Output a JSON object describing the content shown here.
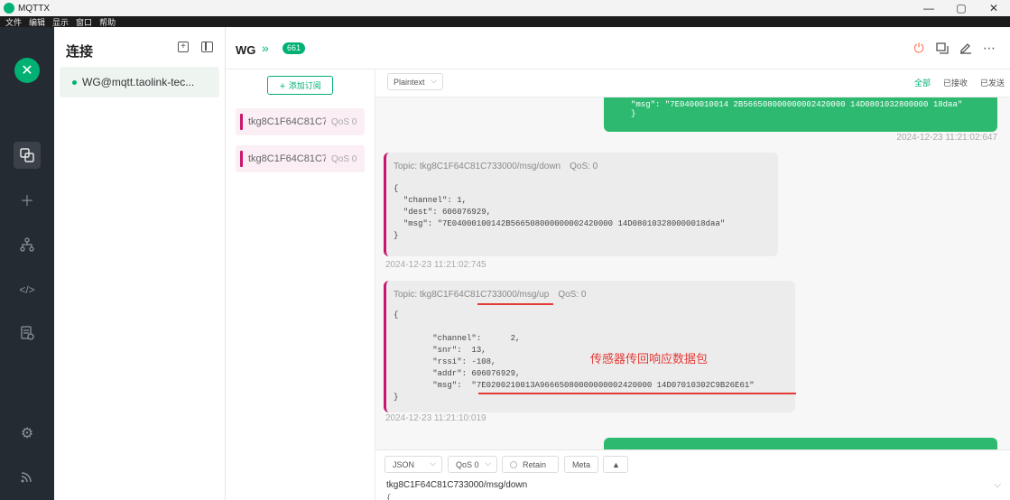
{
  "window": {
    "title": "MQTTX",
    "controls": [
      "—",
      "▢",
      "✕"
    ]
  },
  "menu": [
    "文件",
    "编辑",
    "显示",
    "窗口",
    "帮助"
  ],
  "nav": {
    "logo": "✕",
    "icons": [
      "connections-icon",
      "plus-icon",
      "scripts-icon",
      "code-icon",
      "log-icon",
      "settings-icon",
      "subscribe-icon"
    ]
  },
  "connections": {
    "title": "连接",
    "items": [
      {
        "name": "WG@mqtt.taolink-tec...",
        "status": "connected"
      }
    ]
  },
  "header": {
    "name": "WG",
    "badge": "661"
  },
  "subscriptions": {
    "add_label": "+ 添加订阅",
    "items": [
      {
        "topic": "tkg8C1F64C81C7...",
        "qos": "QoS 0"
      },
      {
        "topic": "tkg8C1F64C81C7...",
        "qos": "QoS 0"
      }
    ]
  },
  "messages": {
    "format": "Plaintext",
    "tabs": [
      "全部",
      "已接收",
      "已发送"
    ],
    "out_top": {
      "payload": "\"msg\": \"7E0400010014 2B566508000000002420000 14D0801032800000 18daa\"\n}",
      "time": "2024-12-23 11:21:02:647"
    },
    "in_1": {
      "topic": "Topic: tkg8C1F64C81C733000/msg/down",
      "qos": "QoS: 0",
      "payload": "{\n  \"channel\": 1,\n  \"dest\": 606076929,\n  \"msg\": \"7E04000100142B566508000000002420000 14D080103280000018daa\"\n}",
      "time": "2024-12-23 11:21:02:745"
    },
    "in_2": {
      "topic": "Topic: tkg8C1F64C81C733000/msg/up",
      "qos": "QoS: 0",
      "payload": "{\n\n        \"channel\":      2,\n        \"snr\":  13,\n        \"rssi\": -108,\n        \"addr\": 606076929,\n        \"msg\":  \"7E0200210013A96665080000000002420000 14D07010302C9B26E61\"\n}",
      "time": "2024-12-23 11:21:10:019"
    },
    "annotation": "传感器传回响应数据包"
  },
  "composer": {
    "format": "JSON",
    "qos": "QoS 0",
    "retain": "Retain",
    "meta": "Meta",
    "up_arrow": "▲",
    "topic": "tkg8C1F64C81C733000/msg/down",
    "payload_start": "{"
  }
}
